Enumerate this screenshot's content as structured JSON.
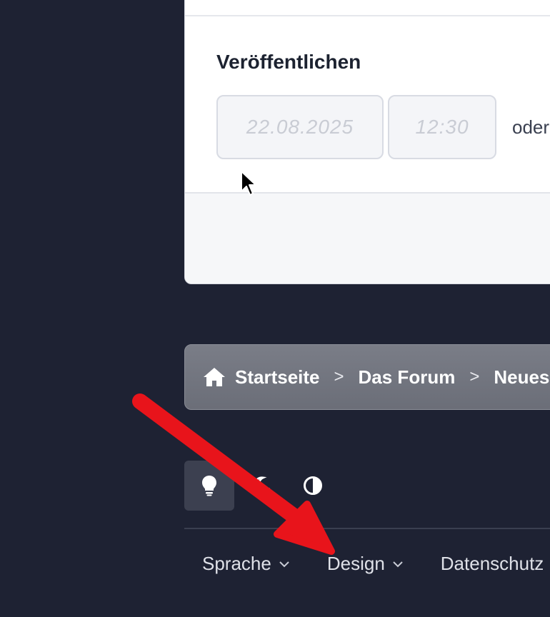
{
  "publish": {
    "title": "Veröffentlichen",
    "date_placeholder": "22.08.2025",
    "time_placeholder": "12:30",
    "oder_text": "oder"
  },
  "breadcrumb": {
    "home_label": "Startseite",
    "forum_label": "Das Forum",
    "current_label": "Neues"
  },
  "theme": {
    "light_icon": "lightbulb-icon",
    "dark_icon": "moon-icon",
    "contrast_icon": "contrast-icon"
  },
  "footer_nav": {
    "language_label": "Sprache",
    "design_label": "Design",
    "privacy_label": "Datenschutz"
  },
  "colors": {
    "background": "#1e2233",
    "annotation_arrow": "#e8141b"
  }
}
